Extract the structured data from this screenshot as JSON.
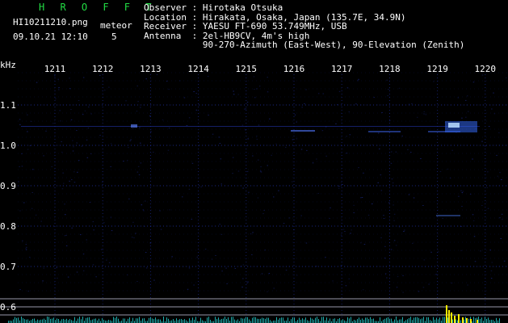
{
  "header": {
    "station_code": "H R O F F T",
    "filename": "HI10211210.png",
    "datetime": "09.10.21 12:10",
    "meteor_label": "meteor",
    "meteor_count": "5"
  },
  "info": {
    "observer_key": "Observer",
    "observer_value": "Hirotaka Otsuka",
    "location_key": "Location",
    "location_value": "Hirakata, Osaka, Japan (135.7E, 34.9N)",
    "receiver_key": "Receiver",
    "receiver_value": "YAESU FT-690 53.749MHz, USB",
    "antenna_key": "Antenna",
    "antenna_value": "2el-HB9CV, 4m's high",
    "antenna_value_2": "90-270-Azimuth (East-West), 90-Elevation (Zenith)"
  },
  "axis": {
    "unit": "kHz",
    "time_ticks": [
      "1211",
      "1212",
      "1213",
      "1214",
      "1215",
      "1216",
      "1217",
      "1218",
      "1219",
      "1220"
    ],
    "freq_ticks": [
      "1.1",
      "1.0",
      "0.9",
      "0.8",
      "0.7",
      "0.6"
    ]
  },
  "colors": {
    "title": "#22dd44",
    "text": "#ffffff",
    "background": "#000000",
    "grid": "#2233aa",
    "signal": "#5599ff",
    "meteor_bright": "#bbddff",
    "spectrum_bar": "#22cccc",
    "spectrum_peak": "#ffee00"
  }
}
